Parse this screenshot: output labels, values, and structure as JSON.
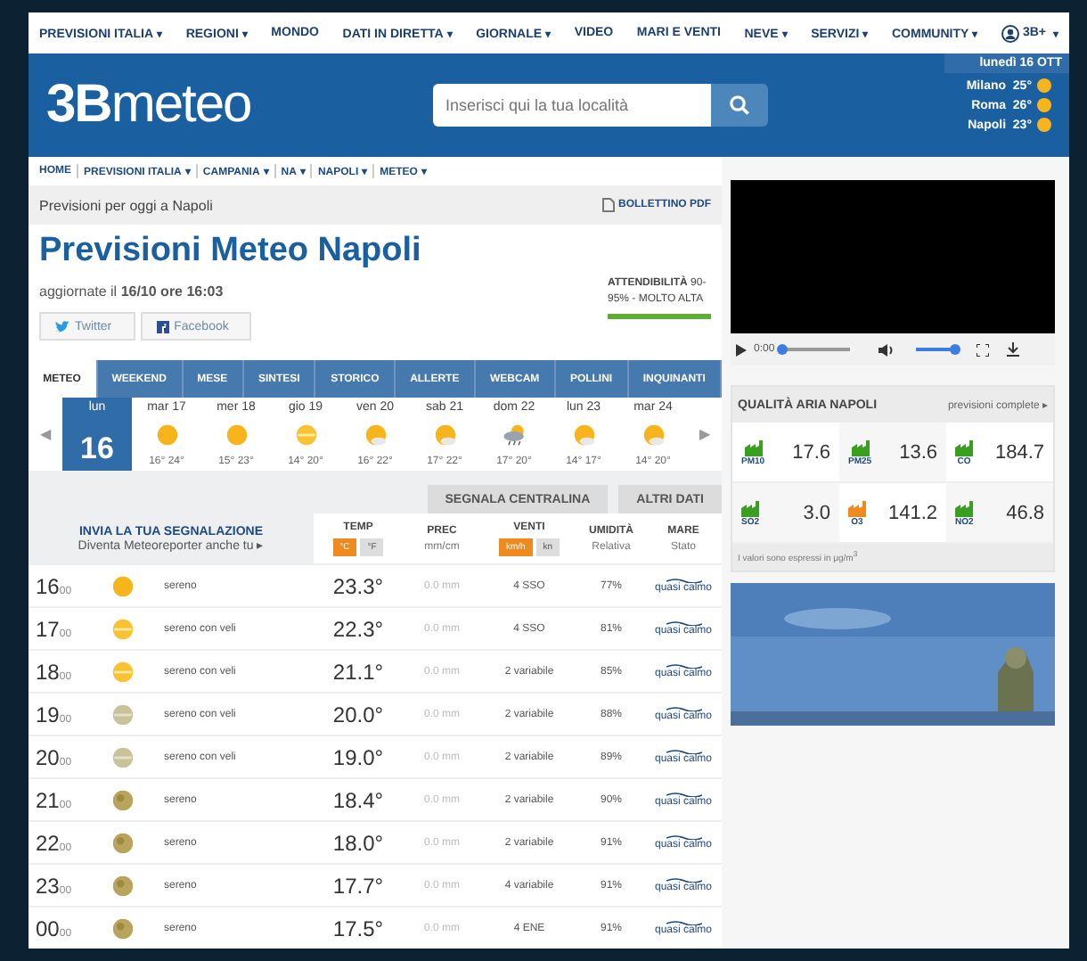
{
  "top_nav": {
    "items": [
      {
        "label": "PREVISIONI ITALIA",
        "caret": "▾"
      },
      {
        "label": "REGIONI",
        "caret": "▾"
      },
      {
        "label": "MONDO"
      },
      {
        "label": "DATI IN DIRETTA",
        "caret": "▾"
      },
      {
        "label": "GIORNALE",
        "caret": "▾"
      },
      {
        "label": "VIDEO"
      },
      {
        "label": "MARI E VENTI"
      },
      {
        "label": "NEVE",
        "caret": "▾"
      },
      {
        "label": "SERVIZI",
        "caret": "▾"
      },
      {
        "label": "COMMUNITY",
        "caret": "▾"
      }
    ],
    "user": "3B+",
    "user_caret": "▾"
  },
  "header": {
    "logo_mark": "3B",
    "logo_text": "meteo",
    "search_placeholder": "Inserisci qui la tua località",
    "date": "lunedì 16 OTT",
    "cities": [
      {
        "name": "Milano",
        "temp": "25°"
      },
      {
        "name": "Roma",
        "temp": "26°"
      },
      {
        "name": "Napoli",
        "temp": "23°"
      }
    ]
  },
  "breadcrumb": [
    {
      "label": "HOME"
    },
    {
      "label": "PREVISIONI ITALIA",
      "caret": "▾"
    },
    {
      "label": "CAMPANIA",
      "caret": "▾"
    },
    {
      "label": "NA",
      "caret": "▾"
    },
    {
      "label": "NAPOLI",
      "caret": "▾"
    },
    {
      "label": "METEO",
      "caret": "▾"
    }
  ],
  "subtitle": "Previsioni per oggi a Napoli",
  "bulletin": "BOLLETTINO PDF",
  "title": "Previsioni Meteo Napoli",
  "updated": "aggiornate il **16/10 ore 16:03**",
  "reliability": {
    "text": "**ATTENDIBILITÀ** 90-95% - MOLTO ALTA",
    "level": 1
  },
  "share_buttons": [
    {
      "kind": "twitter",
      "label": "Twitter"
    },
    {
      "kind": "facebook",
      "label": "Facebook"
    }
  ],
  "tabs": [
    {
      "label": "METEO",
      "selected": true
    },
    {
      "label": "WEEKEND",
      "selected": false
    },
    {
      "label": "MESE",
      "selected": false
    },
    {
      "label": "SINTESI",
      "selected": false
    },
    {
      "label": "STORICO",
      "selected": false
    },
    {
      "label": "ALLERTE",
      "selected": false
    },
    {
      "label": "WEBCAM",
      "selected": false
    },
    {
      "label": "POLLINI",
      "selected": false
    },
    {
      "label": "INQUINANTI",
      "selected": false
    }
  ],
  "day_prev": "◀",
  "day_next": "▶",
  "days": [
    {
      "label": "lun",
      "date": "16",
      "selected": true
    },
    {
      "label": "mar 17",
      "kind": "sun",
      "temps": "16° 24°",
      "selected": false
    },
    {
      "label": "mer 18",
      "kind": "sun",
      "temps": "15° 23°",
      "selected": false
    },
    {
      "label": "gio 19",
      "kind": "haze",
      "temps": "14° 20°",
      "selected": false
    },
    {
      "label": "ven 20",
      "kind": "partly",
      "temps": "16° 22°",
      "selected": false
    },
    {
      "label": "sab 21",
      "kind": "partly",
      "temps": "17° 22°",
      "selected": false
    },
    {
      "label": "dom 22",
      "kind": "rain",
      "temps": "17° 20°",
      "selected": false
    },
    {
      "label": "lun 23",
      "kind": "partly",
      "temps": "14° 17°",
      "selected": false
    },
    {
      "label": "mar 24",
      "kind": "partly",
      "temps": "14° 20°",
      "selected": false
    }
  ],
  "section_buttons": [
    "SEGNALA CENTRALINA",
    "ALTRI DATI"
  ],
  "report": {
    "title": "INVIA LA TUA SEGNALAZIONE",
    "subtitle": "Diventa Meteoreporter anche tu ▸"
  },
  "columns": [
    {
      "title": "TEMP",
      "units": [
        {
          "label": "°C",
          "selected": true
        },
        {
          "label": "°F",
          "selected": false
        }
      ]
    },
    {
      "title": "PREC",
      "sub": "mm/cm"
    },
    {
      "title": "VENTI",
      "units": [
        {
          "label": "km/h",
          "selected": true
        },
        {
          "label": "kn",
          "selected": false
        }
      ]
    },
    {
      "title": "UMIDITÀ",
      "sub": "Relativa"
    },
    {
      "title": "MARE",
      "sub": "Stato"
    }
  ],
  "rows": [
    {
      "hour": "16",
      "min": "00",
      "kind": "sun",
      "desc": "sereno",
      "temp": "23.3°",
      "prec": "0.0 mm",
      "wind": "4 SSO",
      "hum": "77%",
      "sea": "quasi calmo"
    },
    {
      "hour": "17",
      "min": "00",
      "kind": "haze",
      "desc": "sereno con veli",
      "temp": "22.3°",
      "prec": "0.0 mm",
      "wind": "4 SSO",
      "hum": "81%",
      "sea": "quasi calmo"
    },
    {
      "hour": "18",
      "min": "00",
      "kind": "haze",
      "desc": "sereno con veli",
      "temp": "21.1°",
      "prec": "0.0 mm",
      "wind": "2 variabile",
      "hum": "85%",
      "sea": "quasi calmo"
    },
    {
      "hour": "19",
      "min": "00",
      "kind": "nighthaze",
      "desc": "sereno con veli",
      "temp": "20.0°",
      "prec": "0.0 mm",
      "wind": "2 variabile",
      "hum": "88%",
      "sea": "quasi calmo"
    },
    {
      "hour": "20",
      "min": "00",
      "kind": "nighthaze",
      "desc": "sereno con veli",
      "temp": "19.0°",
      "prec": "0.0 mm",
      "wind": "2 variabile",
      "hum": "89%",
      "sea": "quasi calmo"
    },
    {
      "hour": "21",
      "min": "00",
      "kind": "moon",
      "desc": "sereno",
      "temp": "18.4°",
      "prec": "0.0 mm",
      "wind": "2 variabile",
      "hum": "90%",
      "sea": "quasi calmo"
    },
    {
      "hour": "22",
      "min": "00",
      "kind": "moon",
      "desc": "sereno",
      "temp": "18.0°",
      "prec": "0.0 mm",
      "wind": "2 variabile",
      "hum": "91%",
      "sea": "quasi calmo"
    },
    {
      "hour": "23",
      "min": "00",
      "kind": "moon",
      "desc": "sereno",
      "temp": "17.7°",
      "prec": "0.0 mm",
      "wind": "4 variabile",
      "hum": "91%",
      "sea": "quasi calmo"
    },
    {
      "hour": "00",
      "min": "00",
      "kind": "moon",
      "desc": "sereno",
      "temp": "17.5°",
      "prec": "0.0 mm",
      "wind": "4 ENE",
      "hum": "91%",
      "sea": "quasi calmo"
    }
  ],
  "video": {
    "time": "0:00",
    "progress": {
      "level": 0
    },
    "volume": {
      "level": 1
    }
  },
  "air_quality": {
    "title": "QUALITÀ ARIA NAPOLI",
    "link": "previsioni complete ▸",
    "items": [
      {
        "name": "PM10",
        "value": "17.6",
        "color": "#3a9e1e"
      },
      {
        "name": "PM25",
        "value": "13.6",
        "color": "#3a9e1e"
      },
      {
        "name": "CO",
        "value": "184.7",
        "color": "#3a9e1e"
      },
      {
        "name": "SO2",
        "value": "3.0",
        "color": "#3a9e1e"
      },
      {
        "name": "O3",
        "value": "141.2",
        "color": "#ef8a1e"
      },
      {
        "name": "NO2",
        "value": "46.8",
        "color": "#3a9e1e"
      }
    ],
    "note": "I valori sono espressi in μg/m$^{3}$"
  },
  "photo": {
    "kind": "picture"
  }
}
